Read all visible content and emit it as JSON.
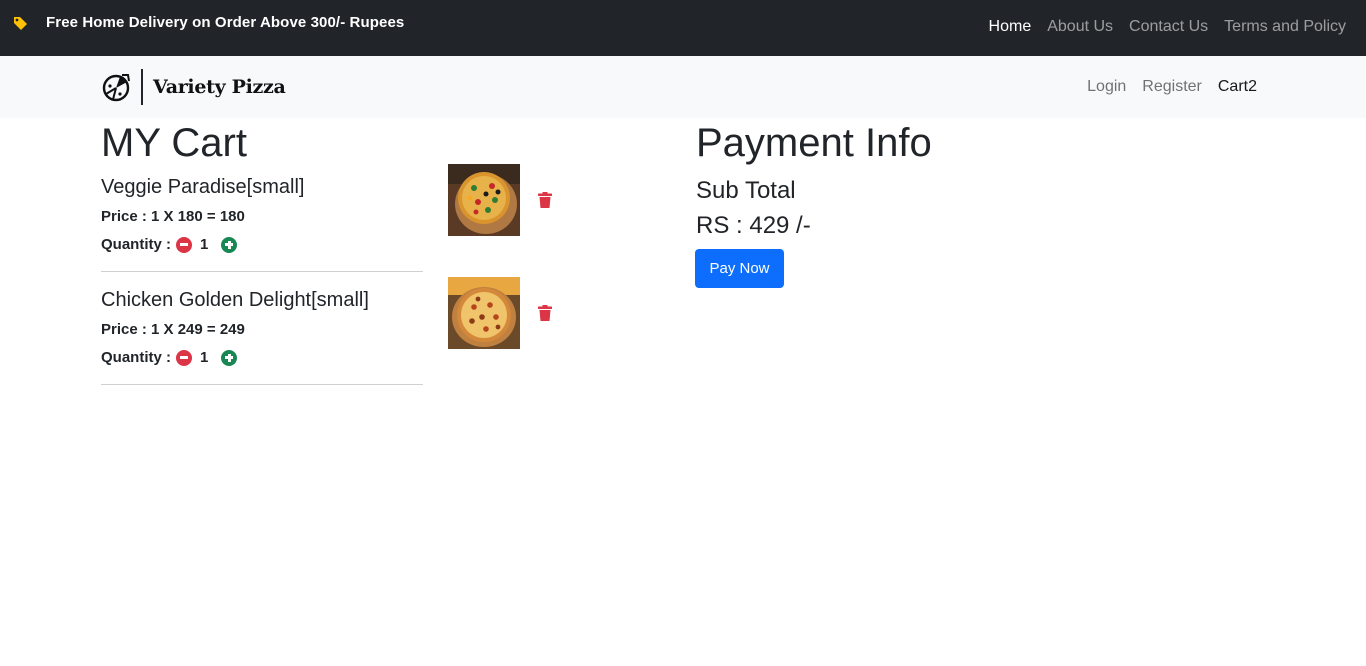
{
  "topbar": {
    "promo_icon": "tag-icon",
    "promo_icon_color": "#ffc107",
    "promo_text": "Free Home Delivery on Order Above 300/- Rupees",
    "nav": [
      "Home",
      "About Us",
      "Contact Us",
      "Terms and Policy"
    ]
  },
  "navbar": {
    "logo_icon": "pizza-logo-icon",
    "brand_name": "Variety Pizza",
    "links": {
      "login": "Login",
      "register": "Register",
      "cart": "Cart2"
    }
  },
  "cart": {
    "title": "MY Cart",
    "qty_label": "Quantity :",
    "items": [
      {
        "name": "Veggie Paradise[small]",
        "price_line": "Price : 1 X 180 = 180",
        "quantity": "1",
        "image": "veggie-pizza-image"
      },
      {
        "name": "Chicken Golden Delight[small]",
        "price_line": "Price : 1 X 249 = 249",
        "quantity": "1",
        "image": "chicken-pizza-image"
      }
    ]
  },
  "payment": {
    "title": "Payment Info",
    "subtotal_label": "Sub Total",
    "subtotal_value": "RS : 429 /-",
    "pay_button": "Pay Now"
  },
  "colors": {
    "topbar_bg": "#212529",
    "navbar_bg": "#f8f9fa",
    "primary": "#0d6efd",
    "danger": "#dc3545",
    "success": "#198754"
  }
}
